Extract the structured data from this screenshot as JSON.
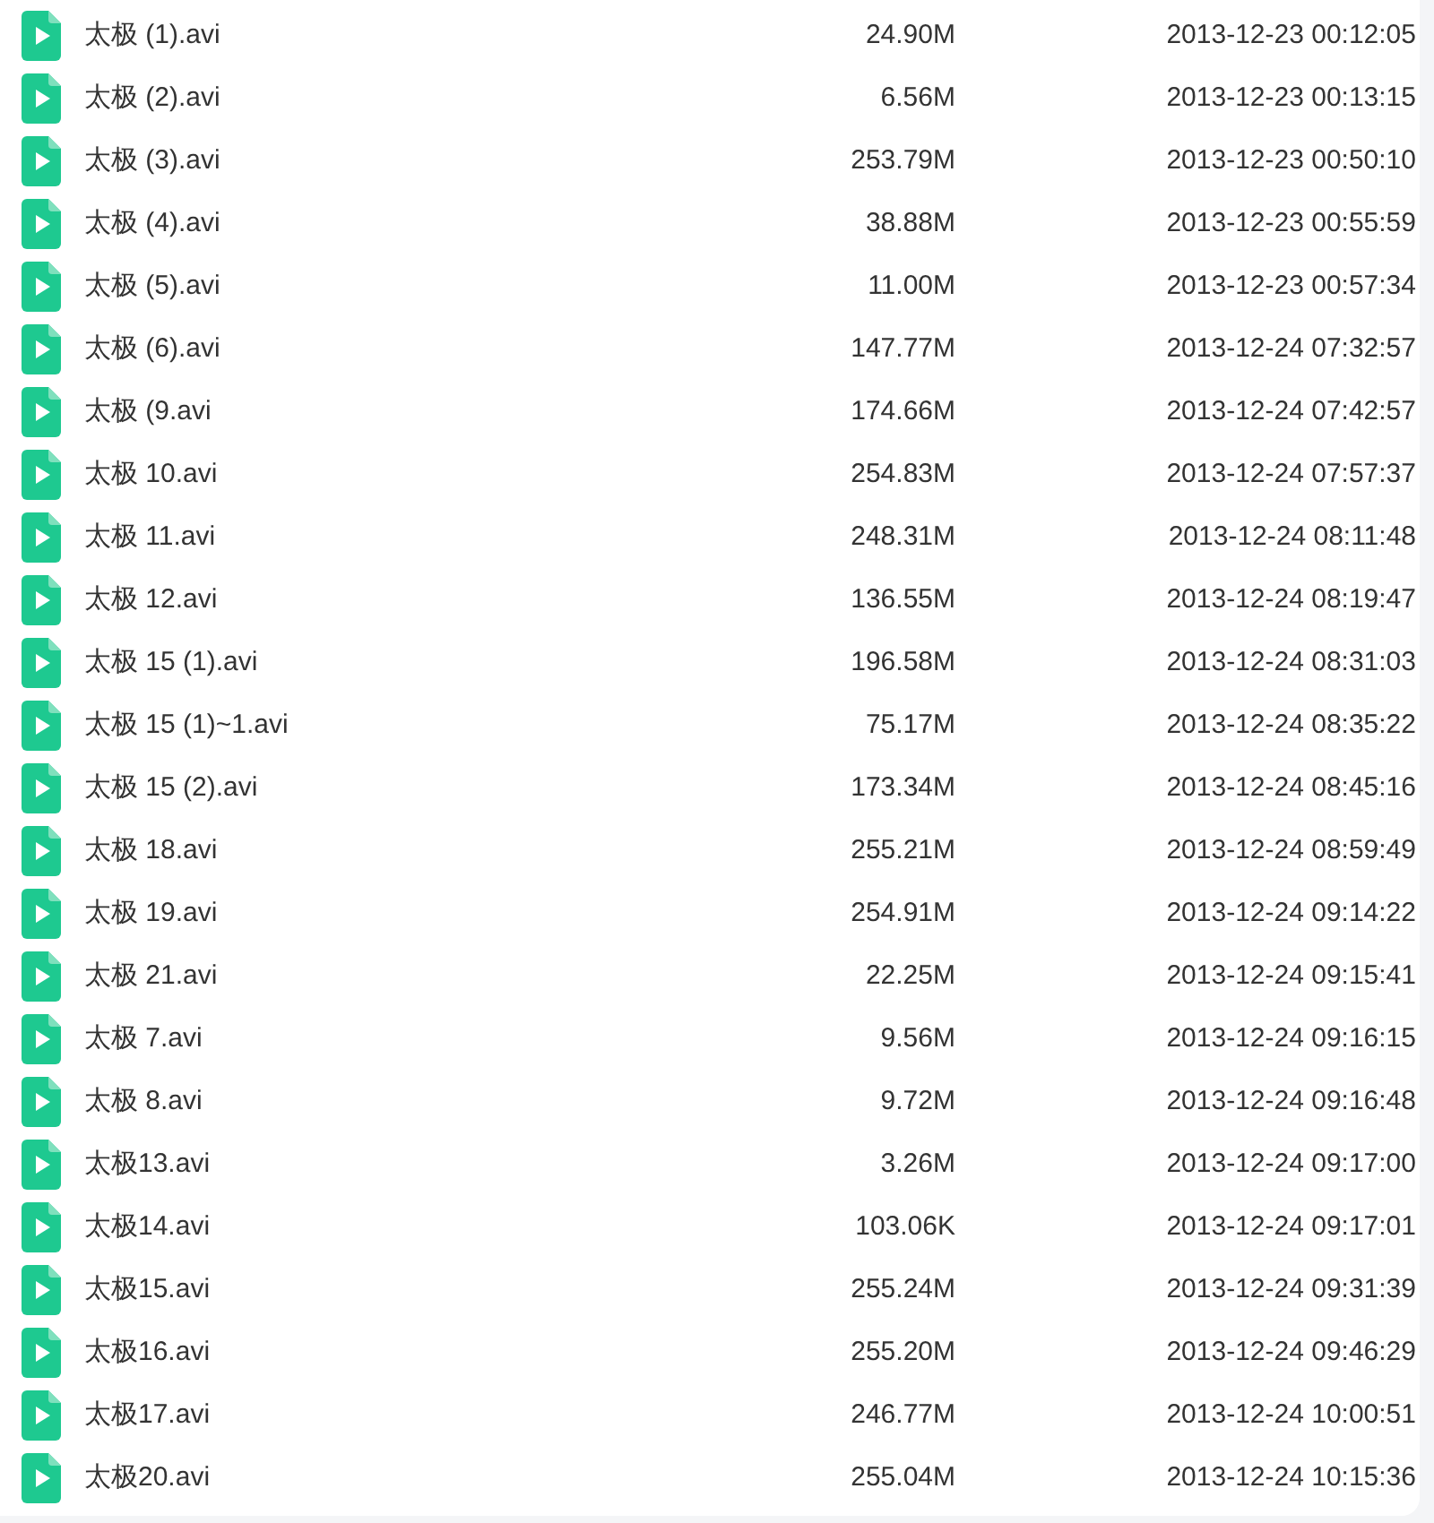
{
  "files": [
    {
      "name": "太极 (1).avi",
      "size": "24.90M",
      "modified": "2013-12-23 00:12:05"
    },
    {
      "name": "太极 (2).avi",
      "size": "6.56M",
      "modified": "2013-12-23 00:13:15"
    },
    {
      "name": "太极 (3).avi",
      "size": "253.79M",
      "modified": "2013-12-23 00:50:10"
    },
    {
      "name": "太极 (4).avi",
      "size": "38.88M",
      "modified": "2013-12-23 00:55:59"
    },
    {
      "name": "太极 (5).avi",
      "size": "11.00M",
      "modified": "2013-12-23 00:57:34"
    },
    {
      "name": "太极 (6).avi",
      "size": "147.77M",
      "modified": "2013-12-24 07:32:57"
    },
    {
      "name": "太极 (9.avi",
      "size": "174.66M",
      "modified": "2013-12-24 07:42:57"
    },
    {
      "name": "太极 10.avi",
      "size": "254.83M",
      "modified": "2013-12-24 07:57:37"
    },
    {
      "name": "太极 11.avi",
      "size": "248.31M",
      "modified": "2013-12-24 08:11:48"
    },
    {
      "name": "太极 12.avi",
      "size": "136.55M",
      "modified": "2013-12-24 08:19:47"
    },
    {
      "name": "太极 15 (1).avi",
      "size": "196.58M",
      "modified": "2013-12-24 08:31:03"
    },
    {
      "name": "太极 15 (1)~1.avi",
      "size": "75.17M",
      "modified": "2013-12-24 08:35:22"
    },
    {
      "name": "太极 15 (2).avi",
      "size": "173.34M",
      "modified": "2013-12-24 08:45:16"
    },
    {
      "name": "太极 18.avi",
      "size": "255.21M",
      "modified": "2013-12-24 08:59:49"
    },
    {
      "name": "太极 19.avi",
      "size": "254.91M",
      "modified": "2013-12-24 09:14:22"
    },
    {
      "name": "太极 21.avi",
      "size": "22.25M",
      "modified": "2013-12-24 09:15:41"
    },
    {
      "name": "太极 7.avi",
      "size": "9.56M",
      "modified": "2013-12-24 09:16:15"
    },
    {
      "name": "太极 8.avi",
      "size": "9.72M",
      "modified": "2013-12-24 09:16:48"
    },
    {
      "name": "太极13.avi",
      "size": "3.26M",
      "modified": "2013-12-24 09:17:00"
    },
    {
      "name": "太极14.avi",
      "size": "103.06K",
      "modified": "2013-12-24 09:17:01"
    },
    {
      "name": "太极15.avi",
      "size": "255.24M",
      "modified": "2013-12-24 09:31:39"
    },
    {
      "name": "太极16.avi",
      "size": "255.20M",
      "modified": "2013-12-24 09:46:29"
    },
    {
      "name": "太极17.avi",
      "size": "246.77M",
      "modified": "2013-12-24 10:00:51"
    },
    {
      "name": "太极20.avi",
      "size": "255.04M",
      "modified": "2013-12-24 10:15:36"
    }
  ]
}
